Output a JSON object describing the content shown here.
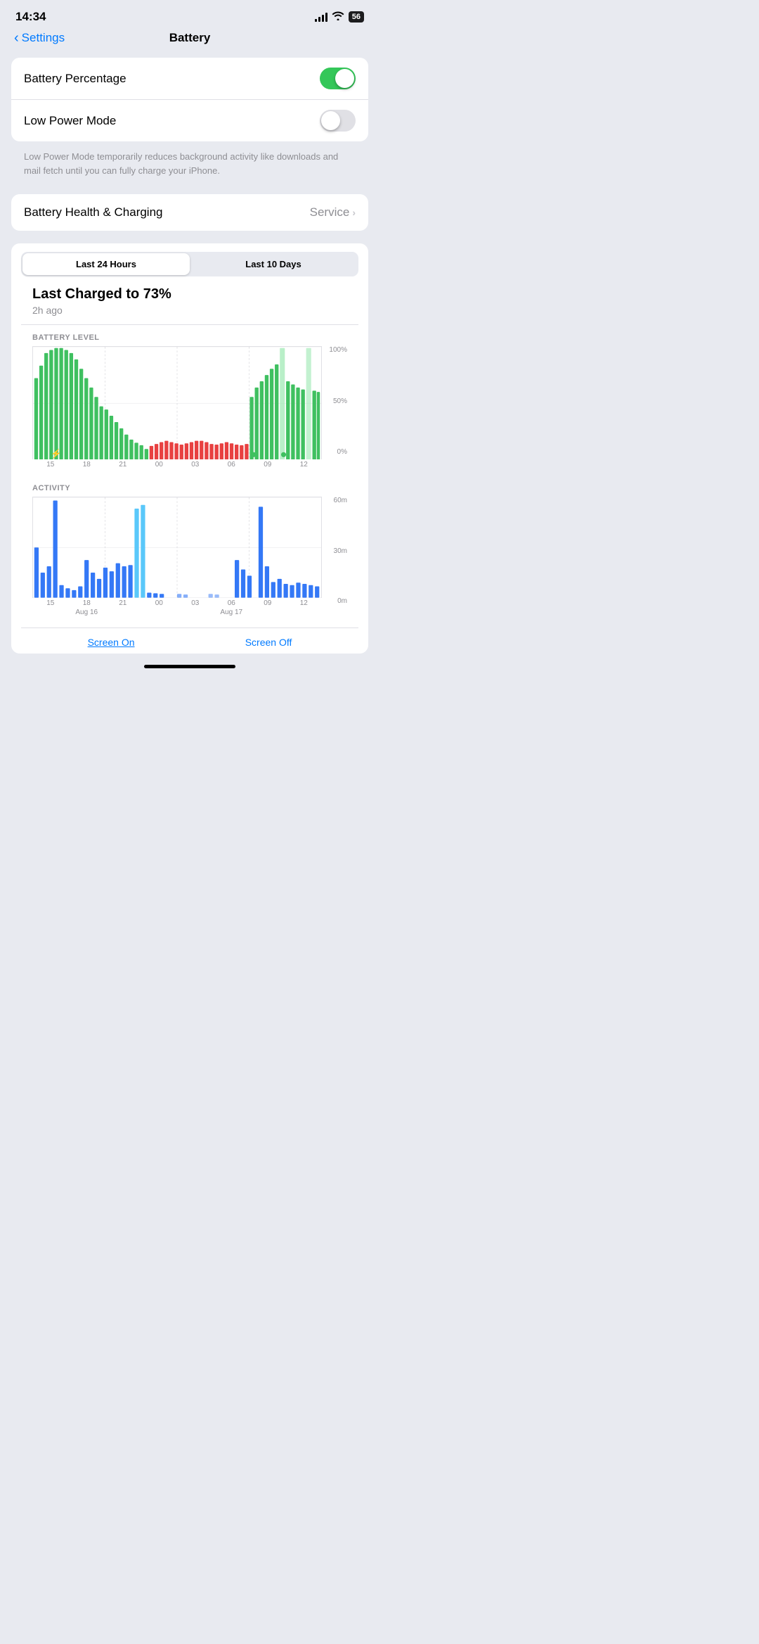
{
  "statusBar": {
    "time": "14:34",
    "batteryLabel": "56"
  },
  "nav": {
    "backLabel": "Settings",
    "title": "Battery"
  },
  "toggles": {
    "batteryPercentage": {
      "label": "Battery Percentage",
      "enabled": true
    },
    "lowPowerMode": {
      "label": "Low Power Mode",
      "enabled": false
    }
  },
  "lowPowerDescription": "Low Power Mode temporarily reduces background activity like downloads and mail fetch until you can fully charge your iPhone.",
  "batteryHealth": {
    "label": "Battery Health & Charging",
    "status": "Service"
  },
  "chartSection": {
    "timeTabs": [
      {
        "label": "Last 24 Hours",
        "active": true
      },
      {
        "label": "Last 10 Days",
        "active": false
      }
    ],
    "chargedTitle": "Last Charged to 73%",
    "chargedSubtitle": "2h ago",
    "batteryLevelLabel": "BATTERY LEVEL",
    "batteryYLabels": [
      "100%",
      "50%",
      "0%"
    ],
    "batteryXLabels": [
      "15",
      "18",
      "21",
      "00",
      "03",
      "06",
      "09",
      "12"
    ],
    "activityLabel": "ACTIVITY",
    "activityYLabels": [
      "60m",
      "30m",
      "0m"
    ],
    "activityXLabels": [
      "15",
      "18",
      "21",
      "00",
      "03",
      "06",
      "09",
      "12"
    ],
    "dateLabels": [
      "Aug 16",
      "Aug 17"
    ]
  },
  "bottomTabs": [
    {
      "label": "Screen On",
      "active": true
    },
    {
      "label": "Screen Off",
      "active": false
    }
  ]
}
